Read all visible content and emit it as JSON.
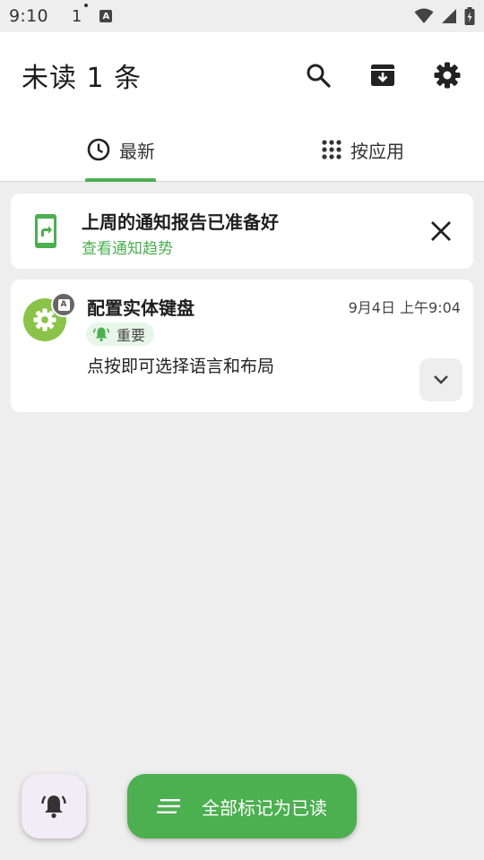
{
  "status_bar": {
    "time": "9:10",
    "notification_count": "1",
    "input_badge": "A"
  },
  "app_bar": {
    "title": "未读 1 条",
    "actions": [
      "search-icon",
      "archive-icon",
      "settings-icon"
    ]
  },
  "tabs": [
    {
      "label": "最新",
      "icon": "clock-icon",
      "selected": true
    },
    {
      "label": "按应用",
      "icon": "apps-grid-icon",
      "selected": false
    }
  ],
  "report_card": {
    "title": "上周的通知报告已准备好",
    "link": "查看通知趋势"
  },
  "notification": {
    "app_badge": "A",
    "title": "配置实体键盘",
    "time": "9月4日 上午9:04",
    "priority": "重要",
    "body": "点按即可选择语言和布局"
  },
  "fab": {
    "mark_all_read": "全部标记为已读"
  },
  "colors": {
    "accent": "#4caf50",
    "app_icon": "#8bc34a",
    "background": "#eeeeee"
  }
}
